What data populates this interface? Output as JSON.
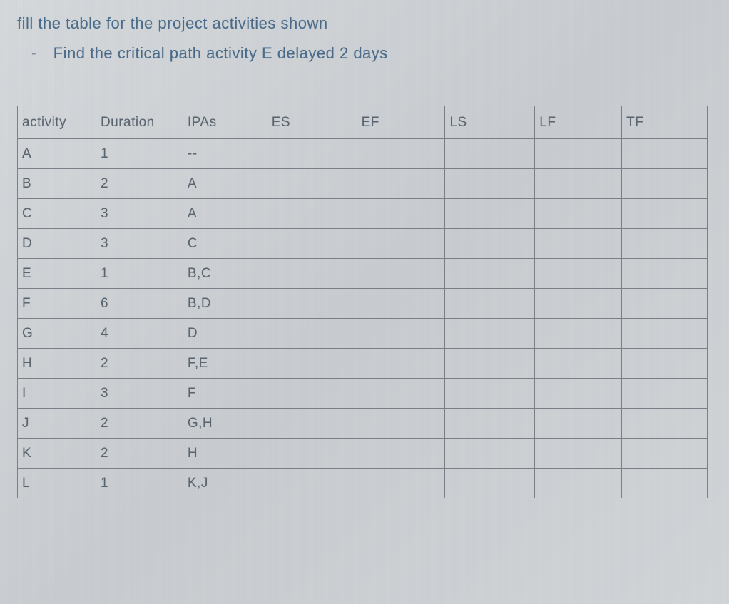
{
  "instructions": {
    "line1": "fill the table for  the project activities shown",
    "dash": "-",
    "line2": "Find the critical path activity E delayed 2 days"
  },
  "table": {
    "headers": {
      "activity": "activity",
      "duration": "Duration",
      "ipas": "IPAs",
      "es": "ES",
      "ef": "EF",
      "ls": "LS",
      "lf": "LF",
      "tf": "TF"
    },
    "rows": [
      {
        "activity": "A",
        "duration": "1",
        "ipas": "--",
        "es": "",
        "ef": "",
        "ls": "",
        "lf": "",
        "tf": ""
      },
      {
        "activity": "B",
        "duration": "2",
        "ipas": "A",
        "es": "",
        "ef": "",
        "ls": "",
        "lf": "",
        "tf": ""
      },
      {
        "activity": "C",
        "duration": "3",
        "ipas": "A",
        "es": "",
        "ef": "",
        "ls": "",
        "lf": "",
        "tf": ""
      },
      {
        "activity": "D",
        "duration": "3",
        "ipas": "C",
        "es": "",
        "ef": "",
        "ls": "",
        "lf": "",
        "tf": ""
      },
      {
        "activity": "E",
        "duration": "1",
        "ipas": "B,C",
        "es": "",
        "ef": "",
        "ls": "",
        "lf": "",
        "tf": ""
      },
      {
        "activity": "F",
        "duration": "6",
        "ipas": "B,D",
        "es": "",
        "ef": "",
        "ls": "",
        "lf": "",
        "tf": ""
      },
      {
        "activity": "G",
        "duration": "4",
        "ipas": "D",
        "es": "",
        "ef": "",
        "ls": "",
        "lf": "",
        "tf": ""
      },
      {
        "activity": "H",
        "duration": "2",
        "ipas": "F,E",
        "es": "",
        "ef": "",
        "ls": "",
        "lf": "",
        "tf": ""
      },
      {
        "activity": "I",
        "duration": "3",
        "ipas": "F",
        "es": "",
        "ef": "",
        "ls": "",
        "lf": "",
        "tf": ""
      },
      {
        "activity": "J",
        "duration": "2",
        "ipas": "G,H",
        "es": "",
        "ef": "",
        "ls": "",
        "lf": "",
        "tf": ""
      },
      {
        "activity": "K",
        "duration": "2",
        "ipas": "H",
        "es": "",
        "ef": "",
        "ls": "",
        "lf": "",
        "tf": ""
      },
      {
        "activity": "L",
        "duration": "1",
        "ipas": "K,J",
        "es": "",
        "ef": "",
        "ls": "",
        "lf": "",
        "tf": ""
      }
    ]
  }
}
